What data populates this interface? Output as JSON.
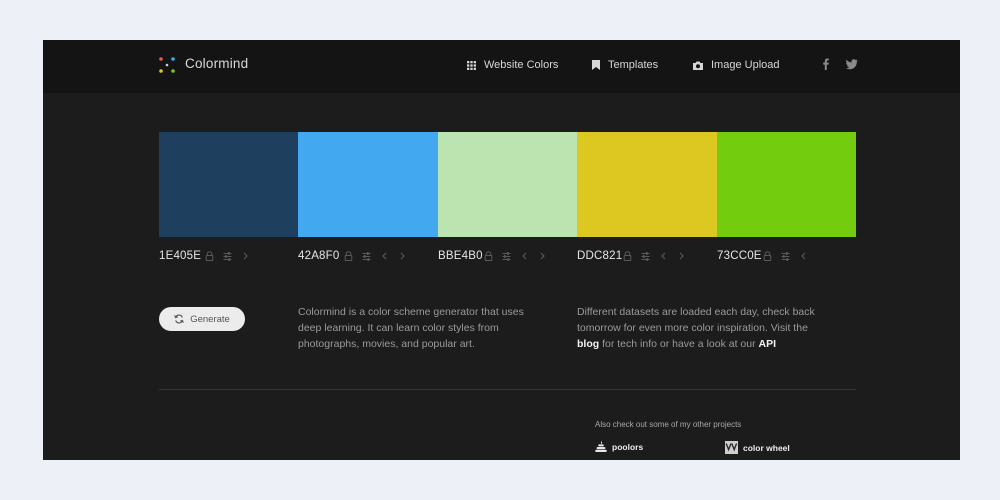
{
  "header": {
    "brand": "Colormind",
    "nav": [
      {
        "label": "Website Colors",
        "icon": "grid-icon"
      },
      {
        "label": "Templates",
        "icon": "bookmark-icon"
      },
      {
        "label": "Image Upload",
        "icon": "camera-icon"
      }
    ],
    "social": [
      "facebook-icon",
      "twitter-icon"
    ]
  },
  "palette": [
    {
      "hex": "1E405E",
      "color": "#1E405E"
    },
    {
      "hex": "42A8F0",
      "color": "#42A8F0"
    },
    {
      "hex": "BBE4B0",
      "color": "#BBE4B0"
    },
    {
      "hex": "DDC821",
      "color": "#DDC821"
    },
    {
      "hex": "73CC0E",
      "color": "#73CC0E"
    }
  ],
  "generate_label": "Generate",
  "intro_text": "Colormind is a color scheme generator that uses deep learning. It can learn color styles from photographs, movies, and popular art.",
  "datasets": {
    "part1": "Different datasets are loaded each day, check back tomorrow for even more color inspiration. Visit the ",
    "blog_link": "blog",
    "part2": " for tech info or have a look at our ",
    "api_link": "API"
  },
  "footer": {
    "also_text": "Also check out some of my other projects",
    "projects": [
      {
        "label": "poolors",
        "icon": "poolors-icon"
      },
      {
        "label": "color wheel",
        "icon": "color-wheel-icon"
      }
    ]
  }
}
